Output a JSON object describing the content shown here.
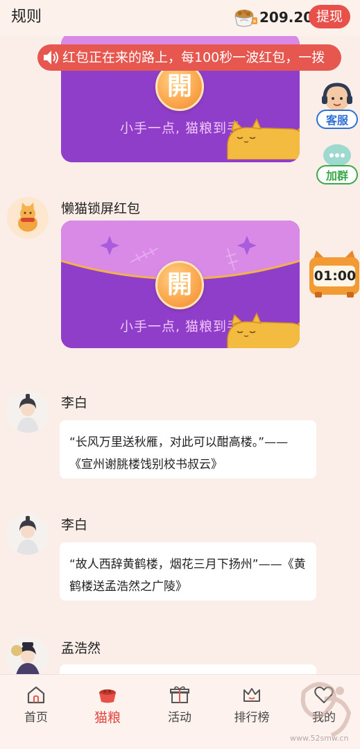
{
  "header": {
    "rules_label": "规则",
    "balance": "209.20",
    "withdraw_label": "提现",
    "bowl_icon": "cat-food-bowl-icon",
    "accent_color": "#e8504a"
  },
  "marquee": {
    "text": "红包正在来的路上，每100秒一波红包，一拨",
    "icon": "speaker-icon"
  },
  "feed": {
    "envelope_top": {
      "open_label": "開",
      "slogan": "小手一点, 猫粮到手"
    },
    "messages": [
      {
        "sender": "懒猫锁屏红包",
        "type": "red-packet",
        "open_label": "開",
        "slogan": "小手一点, 猫粮到手"
      },
      {
        "sender": "李白",
        "type": "quote",
        "text": "“长风万里送秋雁，对此可以酣高楼。”——《宣州谢朓楼饯别校书叔云》"
      },
      {
        "sender": "李白",
        "type": "quote",
        "text": "“故人西辞黄鹤楼，烟花三月下扬州”——《黄鹤楼送孟浩然之广陵》"
      },
      {
        "sender": "孟浩然",
        "type": "quote",
        "text": ""
      }
    ]
  },
  "floating": {
    "service_label": "客服",
    "group_label": "加群",
    "timer": "01:00"
  },
  "bottom_nav": {
    "items": [
      {
        "label": "首页",
        "icon": "home-icon",
        "active": false
      },
      {
        "label": "猫粮",
        "icon": "cat-food-icon",
        "active": true
      },
      {
        "label": "活动",
        "icon": "gift-icon",
        "active": false
      },
      {
        "label": "排行榜",
        "icon": "crown-icon",
        "active": false
      },
      {
        "label": "我的",
        "icon": "heart-profile-icon",
        "active": false
      }
    ]
  },
  "watermark": {
    "url": "www.52smw.cn"
  },
  "colors": {
    "envelope_purple": "#8e3ec9",
    "envelope_flap": "#d98ae6",
    "marquee_red": "#e5574f",
    "background": "#fbeee8",
    "service_blue": "#2f6fd6",
    "group_green": "#3ba84a"
  }
}
